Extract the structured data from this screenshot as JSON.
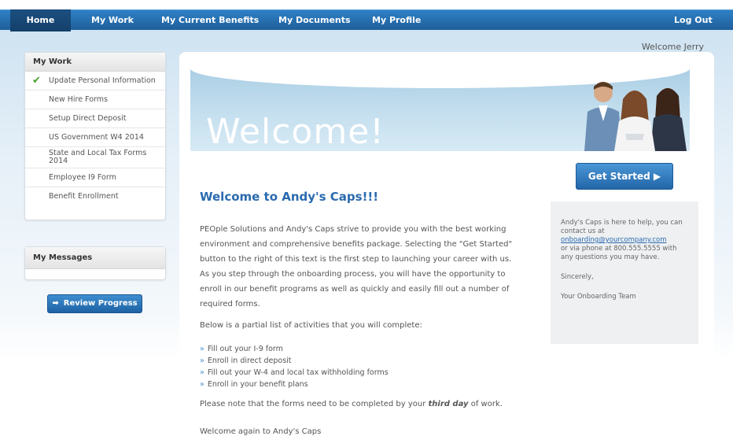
{
  "nav": {
    "home": "Home",
    "my_work": "My Work",
    "benefits": "My Current Benefits",
    "documents": "My Documents",
    "profile": "My Profile",
    "logout": "Log Out"
  },
  "welcome_user": "Welcome Jerry",
  "sidebar": {
    "my_work_title": "My Work",
    "items": [
      {
        "label": "Update Personal Information"
      },
      {
        "label": "New Hire Forms"
      },
      {
        "label": "Setup Direct Deposit"
      },
      {
        "label": "US Government W4 2014"
      },
      {
        "label": "State and Local Tax Forms 2014"
      },
      {
        "label": "Employee I9 Form"
      },
      {
        "label": "Benefit Enrollment"
      }
    ],
    "messages_title": "My Messages",
    "review_label": "Review Progress"
  },
  "hero": {
    "title": "Welcome!"
  },
  "get_started": "Get Started",
  "content": {
    "title": "Welcome to Andy's Caps!!!",
    "paragraph": "PEOple Solutions and Andy's Caps strive to provide you with the best working environment and comprehensive benefits package. Selecting the \"Get Started\" button to the right of this text is the first step to launching your career with us. As you step through the onboarding process, you will have the opportunity to enroll in our benefit programs as well as quickly and easily fill out a number of required forms.",
    "list_intro": "Below is a partial list of activities that you will complete:",
    "bullets": [
      "Fill out your I-9 form",
      "Enroll in direct deposit",
      "Fill out your W-4 and local tax withholding forms",
      "Enroll in your benefit plans"
    ],
    "note_prefix": "Please note that the forms need to be completed by your ",
    "note_emphasis": "third day",
    "note_suffix": " of work.",
    "closing": "Welcome again to Andy's Caps"
  },
  "help": {
    "line1": "Andy's Caps is here to help, you can contact us at",
    "email": "onboarding@yourcompany.com",
    "line2": "or via phone at 800.555.5555 with any questions you may have.",
    "sincerely": "Sincerely,",
    "signature": "Your Onboarding Team"
  },
  "colors": {
    "nav": "#1f5f9a",
    "accent": "#2a6aae",
    "check": "#4aa02c"
  }
}
